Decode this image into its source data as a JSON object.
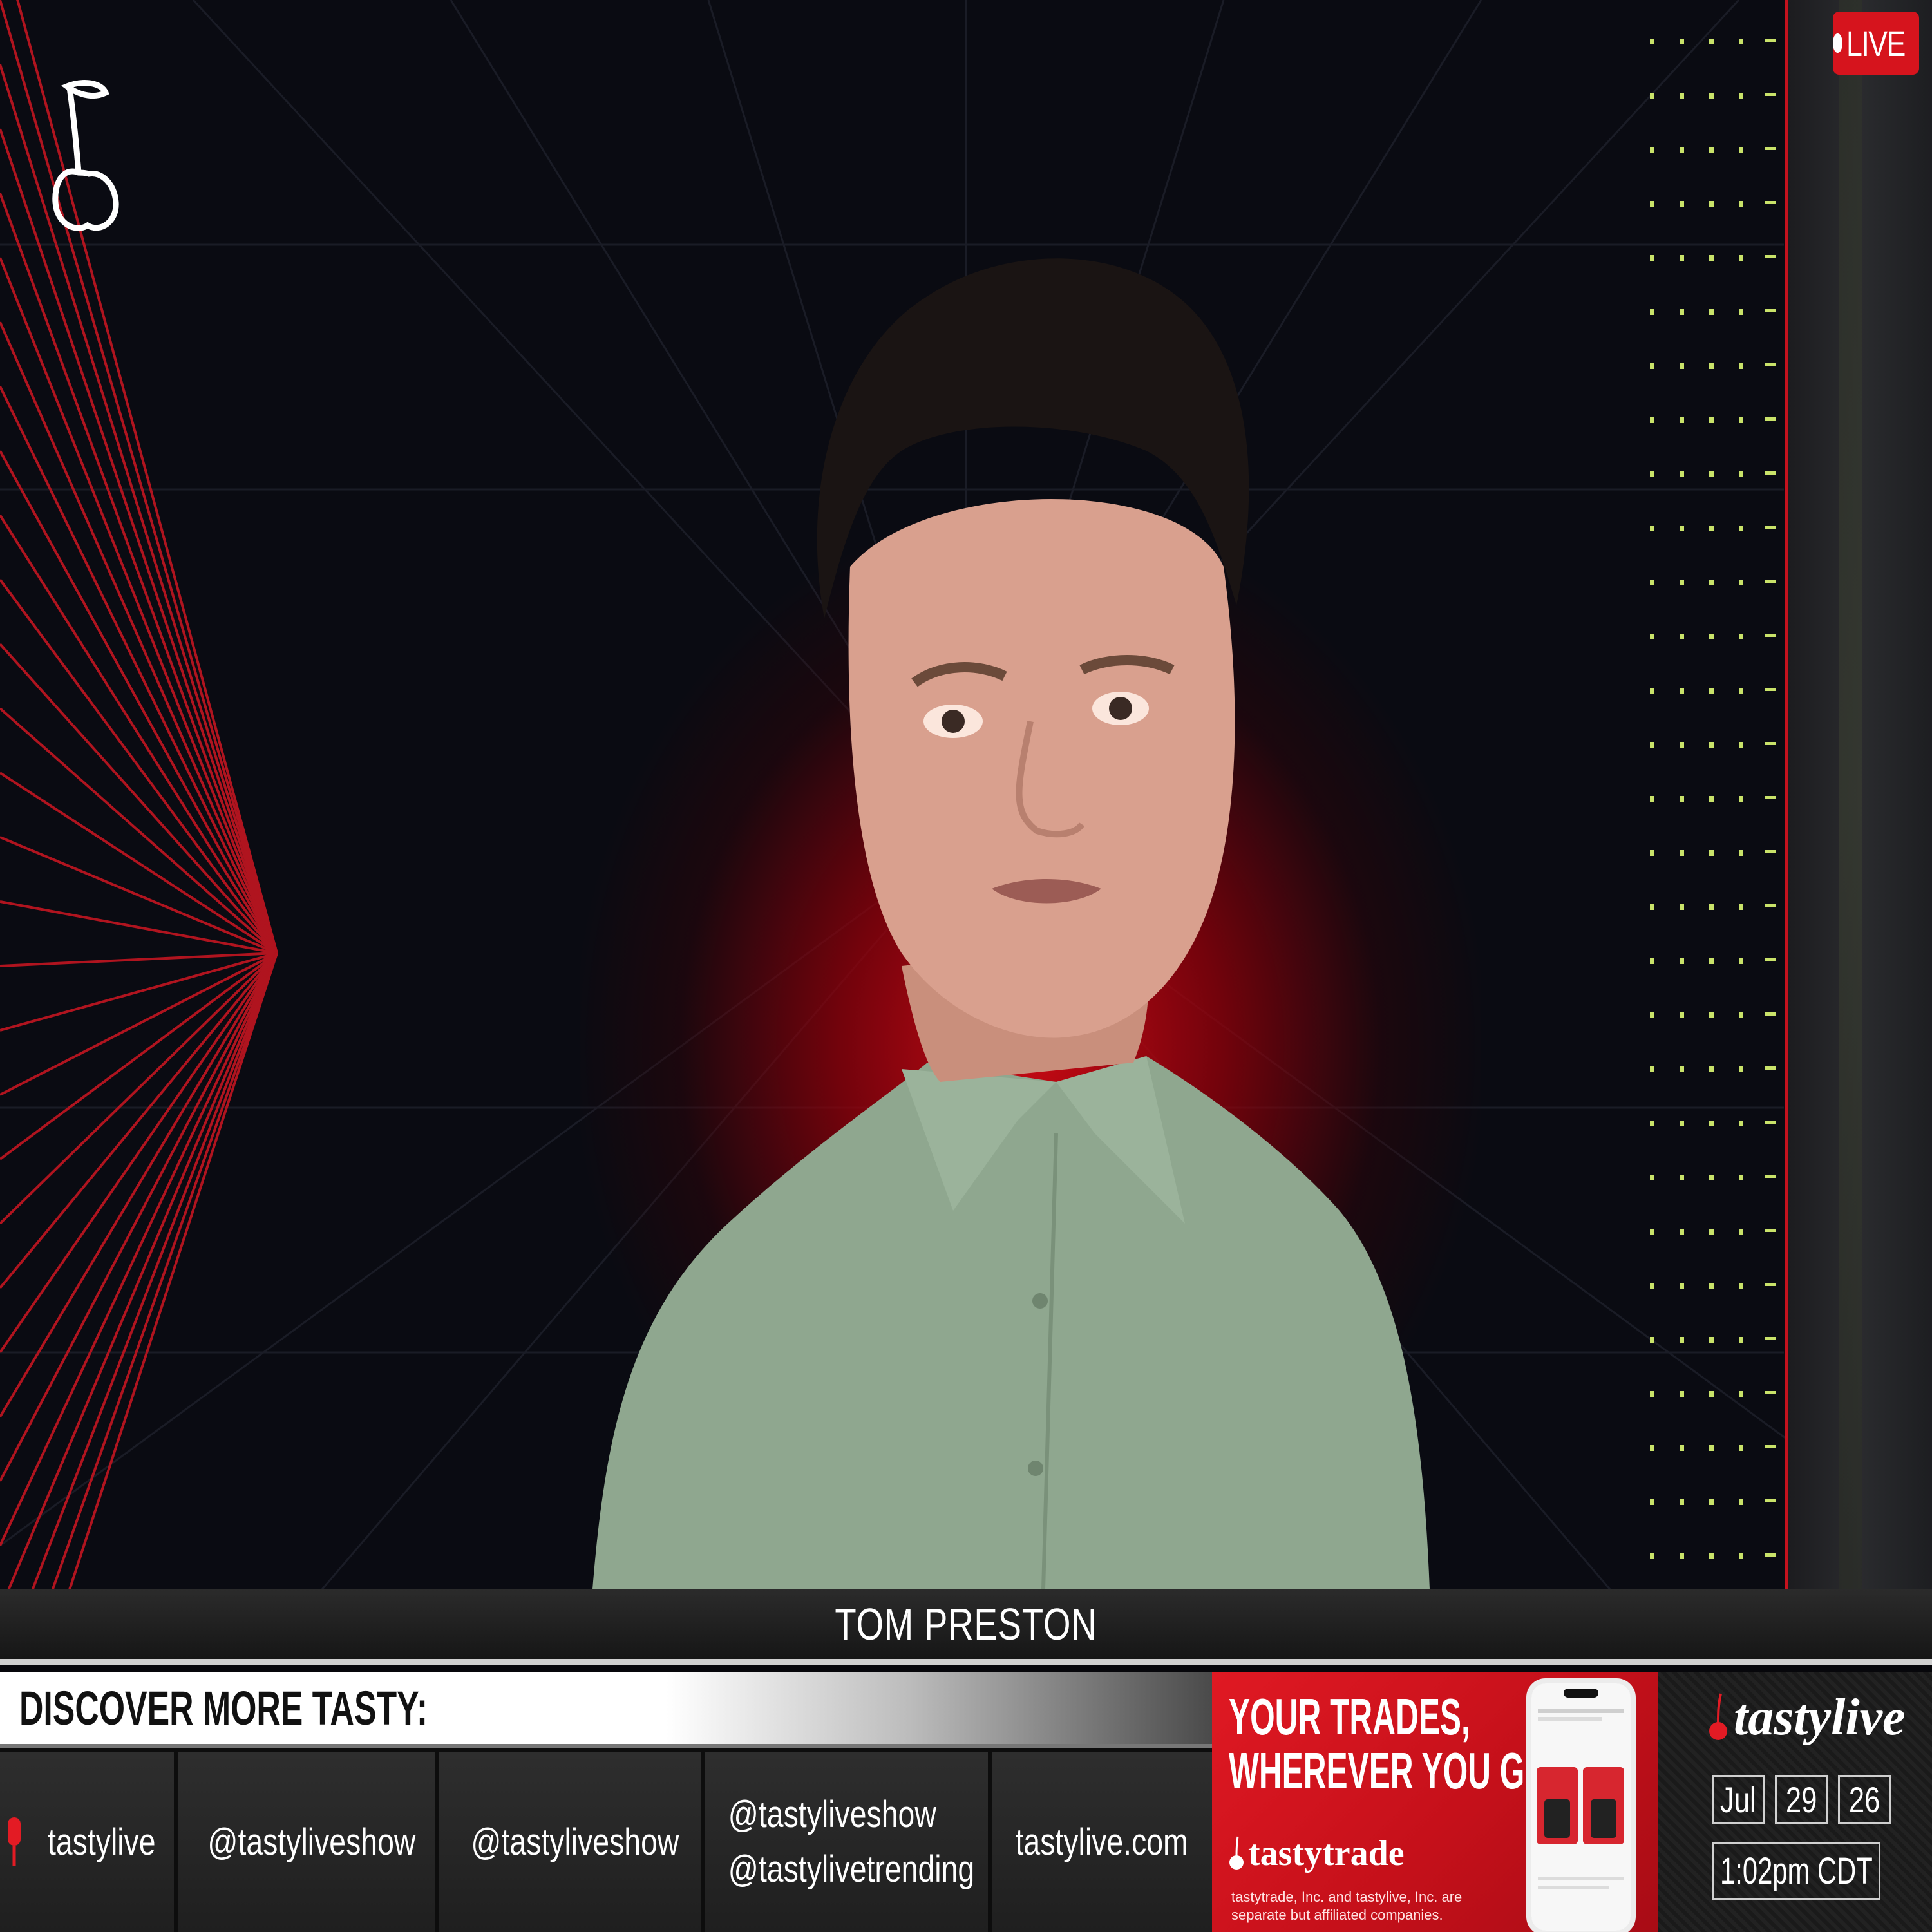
{
  "broadcast": {
    "live_label": "LIVE",
    "presenter_name": "TOM PRESTON"
  },
  "lower_third": {
    "header": "DISCOVER MORE TASTY:",
    "social": [
      {
        "icon": "microphone-icon",
        "label": "tastylive"
      },
      {
        "icon": "x-logo-icon",
        "label": "@tastyliveshow"
      },
      {
        "icon": "instagram-icon",
        "label": "@tastyliveshow"
      },
      {
        "icon": "youtube-icon",
        "labels": [
          "@tastyliveshow",
          "@tastylivetrending"
        ]
      },
      {
        "icon": "",
        "label": "tastylive.com"
      }
    ]
  },
  "promo": {
    "headline_line1": "YOUR TRADES,",
    "headline_line2": "WHEREVER YOU GO",
    "brand": "tastytrade",
    "disclaimer": "tastytrade, Inc. and tastylive, Inc. are separate but affiliated companies."
  },
  "brand_block": {
    "logo": "tastylive",
    "month": "Jul",
    "day": "29",
    "year": "26",
    "time": "1:02pm CDT"
  },
  "colors": {
    "accent_red": "#d6141d",
    "background": "#0a0b12",
    "shirt": "#8ea88f"
  }
}
